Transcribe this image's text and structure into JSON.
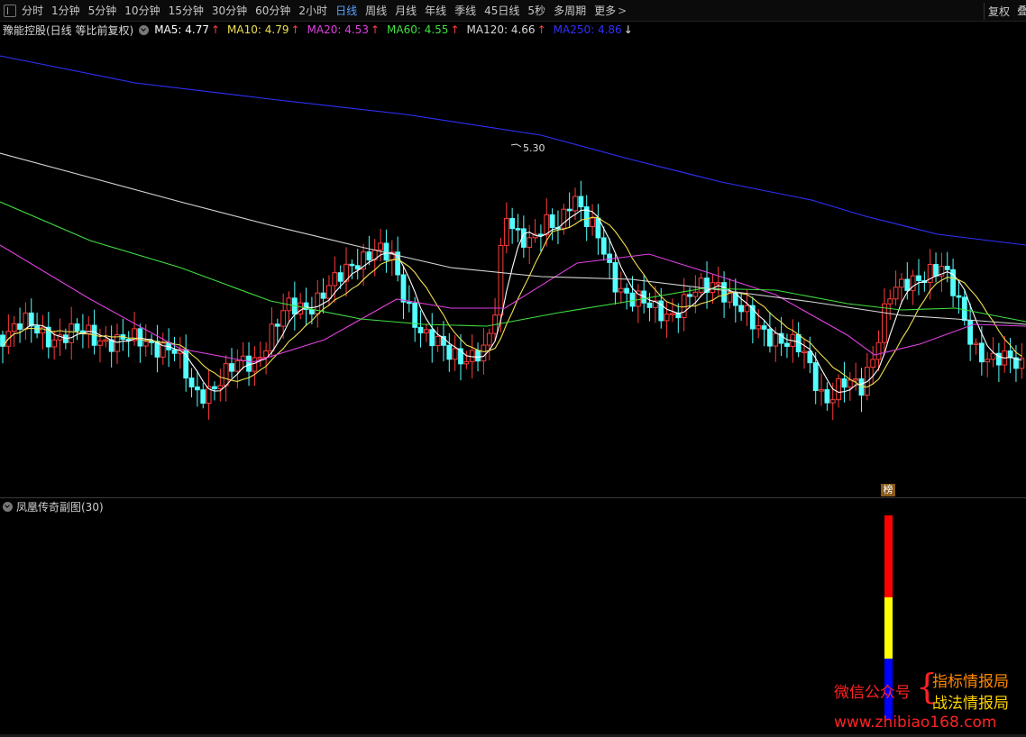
{
  "toolbar": {
    "tabs": [
      {
        "label": "分时"
      },
      {
        "label": "1分钟"
      },
      {
        "label": "5分钟"
      },
      {
        "label": "10分钟"
      },
      {
        "label": "15分钟"
      },
      {
        "label": "30分钟"
      },
      {
        "label": "60分钟"
      },
      {
        "label": "2小时"
      },
      {
        "label": "日线"
      },
      {
        "label": "周线"
      },
      {
        "label": "月线"
      },
      {
        "label": "年线"
      },
      {
        "label": "季线"
      },
      {
        "label": "45日线"
      },
      {
        "label": "5秒"
      },
      {
        "label": "多周期"
      },
      {
        "label": "更多"
      }
    ],
    "active_tab": "日线",
    "more_arrow": ">",
    "restore_label": "复权",
    "corner_label": "叠"
  },
  "main_chart": {
    "stock_title": "豫能控股(日线 等比前复权)",
    "ma_items": [
      {
        "label": "MA5:",
        "value": "4.77",
        "color": "#ffffff",
        "arrow": "↑"
      },
      {
        "label": "MA10:",
        "value": "4.79",
        "color": "#f0e050",
        "arrow": "↑"
      },
      {
        "label": "MA20:",
        "value": "4.53",
        "color": "#e040e0",
        "arrow": "↑"
      },
      {
        "label": "MA60:",
        "value": "4.55",
        "color": "#40e040",
        "arrow": "↑"
      },
      {
        "label": "MA120:",
        "value": "4.66",
        "color": "#d8d8d8",
        "arrow": "↑"
      },
      {
        "label": "MA250:",
        "value": "4.86",
        "color": "#3030ff",
        "arrow": "↓"
      }
    ],
    "high_marker": "5.30",
    "badge": "榜"
  },
  "sub_chart": {
    "label": "凤凰传奇副图(30)",
    "bar_segments": [
      {
        "color": "#ff0000",
        "level": 0.4
      },
      {
        "color": "#ffff00",
        "level": 0.3
      },
      {
        "color": "#0000ff",
        "level": 0.3
      }
    ]
  },
  "watermark": {
    "left_text": "微信公众号",
    "brace": "{",
    "right_line1": "指标情报局",
    "right_line2": "战法情报局",
    "url": "www.zhibiao168.com"
  },
  "colors": {
    "up": "#ff3c3c",
    "down": "#54ffff",
    "ma5": "#ffffff",
    "ma10": "#f0e050",
    "ma20": "#e040e0",
    "ma60": "#40e040",
    "ma120": "#d8d8d8",
    "ma250": "#3030ff"
  }
}
